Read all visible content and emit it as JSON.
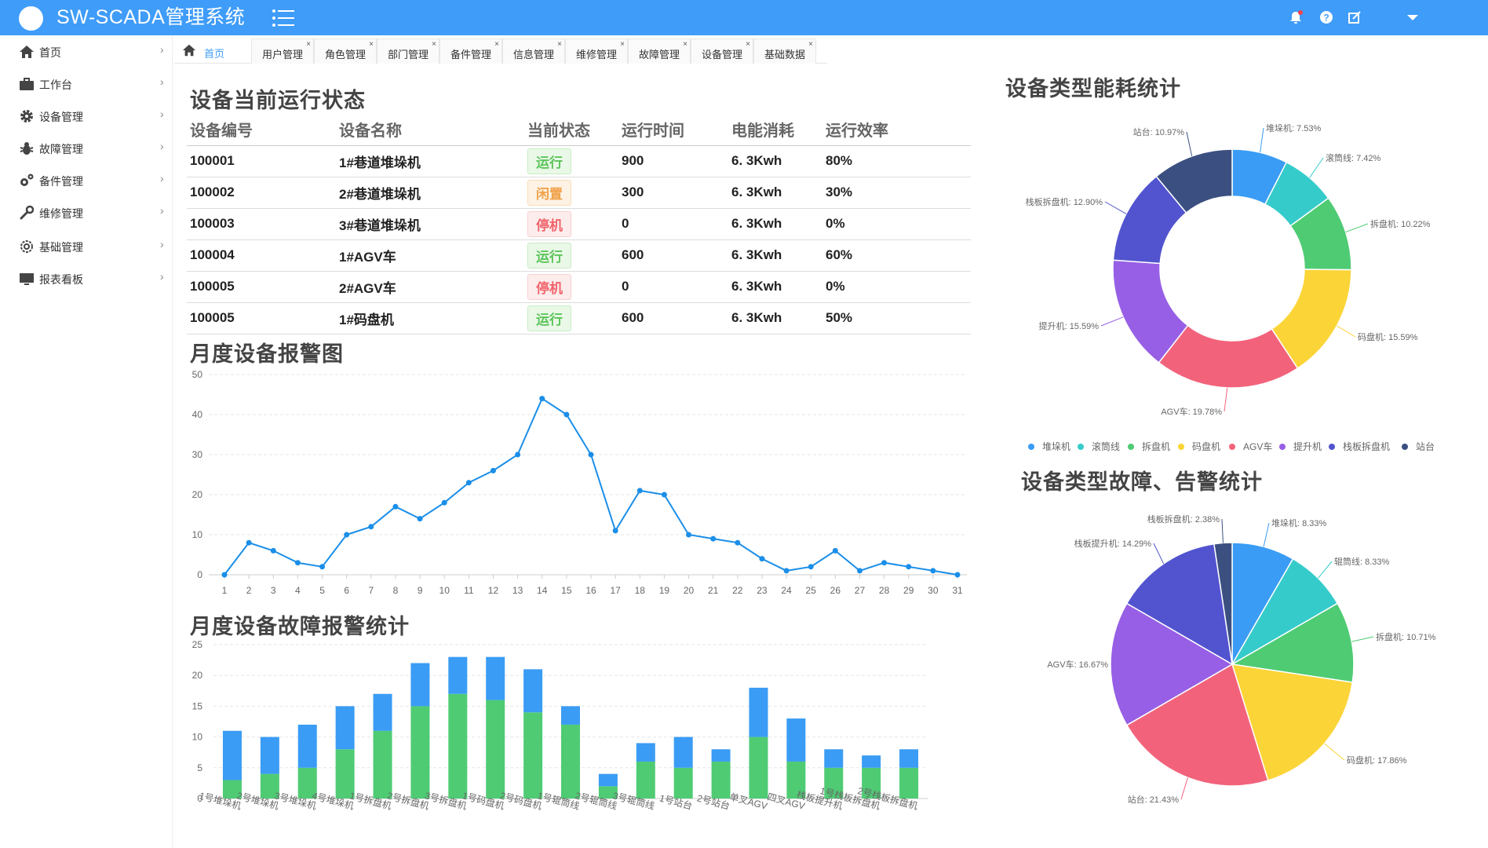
{
  "header": {
    "title": "SW-SCADA管理系统",
    "icons": [
      "menu-icon",
      "bell-icon",
      "help-icon",
      "edit-icon",
      "caret-down-icon"
    ]
  },
  "sidebar": {
    "items": [
      {
        "label": "首页",
        "icon": "home-icon"
      },
      {
        "label": "工作台",
        "icon": "briefcase-icon"
      },
      {
        "label": "设备管理",
        "icon": "gear-icon"
      },
      {
        "label": "故障管理",
        "icon": "bug-icon"
      },
      {
        "label": "备件管理",
        "icon": "gears-icon"
      },
      {
        "label": "维修管理",
        "icon": "wrench-icon"
      },
      {
        "label": "基础管理",
        "icon": "cog-outline-icon"
      },
      {
        "label": "报表看板",
        "icon": "monitor-icon"
      }
    ],
    "arrow": "›"
  },
  "tabs": {
    "home": "首页",
    "items": [
      "用户管理",
      "角色管理",
      "部门管理",
      "备件管理",
      "信息管理",
      "维修管理",
      "故障管理",
      "设备管理",
      "基础数据"
    ],
    "close": "×"
  },
  "status": {
    "title": "设备当前运行状态",
    "headers": [
      "设备编号",
      "设备名称",
      "当前状态",
      "运行时间",
      "电能消耗",
      "运行效率"
    ],
    "rows": [
      {
        "id": "100001",
        "name": "1#巷道堆垛机",
        "state": "运行",
        "kind": "run",
        "time": "900",
        "energy": "6. 3Kwh",
        "eff": "80%"
      },
      {
        "id": "100002",
        "name": "2#巷道堆垛机",
        "state": "闲置",
        "kind": "idle",
        "time": "300",
        "energy": "6. 3Kwh",
        "eff": "30%"
      },
      {
        "id": "100003",
        "name": "3#巷道堆垛机",
        "state": "停机",
        "kind": "stop",
        "time": "0",
        "energy": "6. 3Kwh",
        "eff": "0%"
      },
      {
        "id": "100004",
        "name": "1#AGV车",
        "state": "运行",
        "kind": "run",
        "time": "600",
        "energy": "6. 3Kwh",
        "eff": "60%"
      },
      {
        "id": "100005",
        "name": "2#AGV车",
        "state": "停机",
        "kind": "stop",
        "time": "0",
        "energy": "6. 3Kwh",
        "eff": "0%"
      },
      {
        "id": "100005",
        "name": "1#码盘机",
        "state": "运行",
        "kind": "run",
        "time": "600",
        "energy": "6. 3Kwh",
        "eff": "50%"
      }
    ]
  },
  "colors": {
    "accent": "#3f9cf8",
    "line": "#1a8ee8",
    "barBlue": "#3a9cf4",
    "barGreen": "#4fcb74",
    "slices": [
      "#3a9cf4",
      "#36cbcb",
      "#4fcb74",
      "#fbd437",
      "#f2637b",
      "#975fe5",
      "#5254cf",
      "#3b4f80"
    ]
  },
  "chart_data": [
    {
      "type": "line",
      "title": "月度设备报警图",
      "x": [
        "1",
        "2",
        "3",
        "4",
        "5",
        "6",
        "7",
        "8",
        "9",
        "10",
        "11",
        "12",
        "13",
        "14",
        "15",
        "16",
        "17",
        "18",
        "19",
        "20",
        "21",
        "22",
        "23",
        "24",
        "25",
        "26",
        "27",
        "28",
        "29",
        "30",
        "31"
      ],
      "values": [
        0,
        8,
        6,
        3,
        2,
        10,
        12,
        17,
        14,
        18,
        23,
        26,
        30,
        44,
        40,
        30,
        11,
        21,
        20,
        10,
        9,
        8,
        4,
        1,
        2,
        6,
        1,
        3,
        2,
        1,
        0
      ],
      "ylim": [
        0,
        50
      ],
      "yticks": [
        "0",
        "10",
        "20",
        "30",
        "40",
        "50"
      ],
      "grid": true
    },
    {
      "type": "bar",
      "stacked": true,
      "title": "月度设备故障报警统计",
      "categories": [
        "1号堆垛机",
        "2号堆垛机",
        "3号堆垛机",
        "4号堆垛机",
        "1号拆盘机",
        "2号拆盘机",
        "3号拆盘机",
        "1号码盘机",
        "2号码盘机",
        "1号辊筒线",
        "2号辊筒线",
        "3号辊筒线",
        "1号站台",
        "2号站台",
        "单叉AGV",
        "四叉AGV",
        "栈板提升机",
        "1号栈板拆盘机",
        "2号栈板拆盘机"
      ],
      "series": [
        {
          "values": [
            3,
            4,
            5,
            8,
            11,
            15,
            17,
            16,
            14,
            12,
            2,
            6,
            5,
            6,
            10,
            6,
            5,
            5,
            5
          ]
        },
        {
          "values": [
            8,
            6,
            7,
            7,
            6,
            7,
            6,
            7,
            7,
            3,
            2,
            3,
            5,
            2,
            8,
            7,
            3,
            2,
            3
          ]
        }
      ],
      "ylim": [
        0,
        25
      ],
      "yticks": [
        "0",
        "5",
        "10",
        "15",
        "20",
        "25"
      ],
      "grid": true
    },
    {
      "type": "pie",
      "donut": true,
      "title": "设备类型能耗统计",
      "categories": [
        "堆垛机",
        "滚筒线",
        "拆盘机",
        "码盘机",
        "AGV车",
        "提升机",
        "栈板拆盘机",
        "站台"
      ],
      "values": [
        7.53,
        7.42,
        10.22,
        15.59,
        19.78,
        15.59,
        12.9,
        10.97
      ],
      "labels": [
        "堆垛机: 7.53%",
        "滚筒线: 7.42%",
        "拆盘机: 10.22%",
        "码盘机: 15.59%",
        "AGV车: 19.78%",
        "提升机: 15.59%",
        "栈板拆盘机: 12.90%",
        "站台: 10.97%"
      ],
      "legend": "bottom"
    },
    {
      "type": "pie",
      "title": "设备类型故障、告警统计",
      "categories": [
        "堆垛机",
        "辊筒线",
        "拆盘机",
        "码盘机",
        "站台",
        "AGV车",
        "栈板提升机",
        "栈板拆盘机"
      ],
      "values": [
        8.33,
        8.33,
        10.71,
        17.86,
        21.43,
        16.67,
        14.29,
        2.38
      ],
      "labels": [
        "堆垛机: 8.33%",
        "辊筒线: 8.33%",
        "拆盘机: 10.71%",
        "码盘机: 17.86%",
        "站台: 21.43%",
        "AGV车: 16.67%",
        "栈板提升机: 14.29%",
        "栈板拆盘机: 2.38%"
      ]
    }
  ]
}
